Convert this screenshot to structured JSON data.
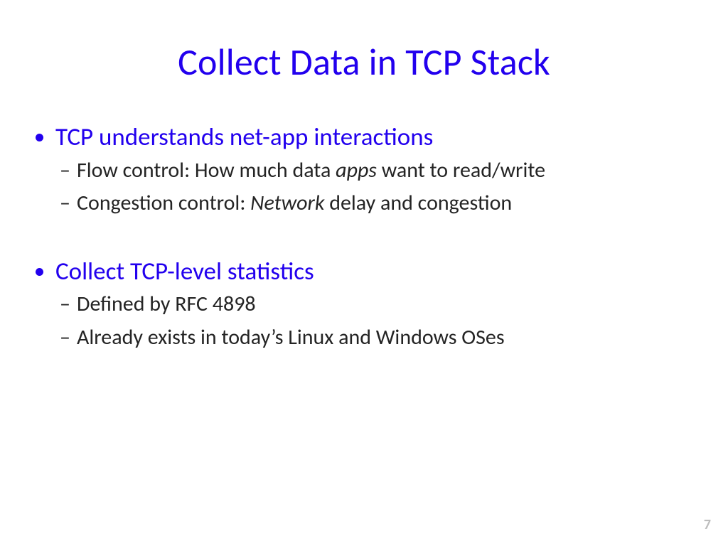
{
  "title": "Collect Data in TCP Stack",
  "b1": "TCP understands net-app interactions",
  "b1s1a": "Flow control: How much data ",
  "b1s1b": "apps",
  "b1s1c": " want to read/write",
  "b1s2a": "Congestion control: ",
  "b1s2b": "Network",
  "b1s2c": " delay and congestion",
  "b2": "Collect TCP-level statistics",
  "b2s1": "Defined by RFC 4898",
  "b2s2": "Already exists in today’s Linux and Windows OSes",
  "page": "7"
}
